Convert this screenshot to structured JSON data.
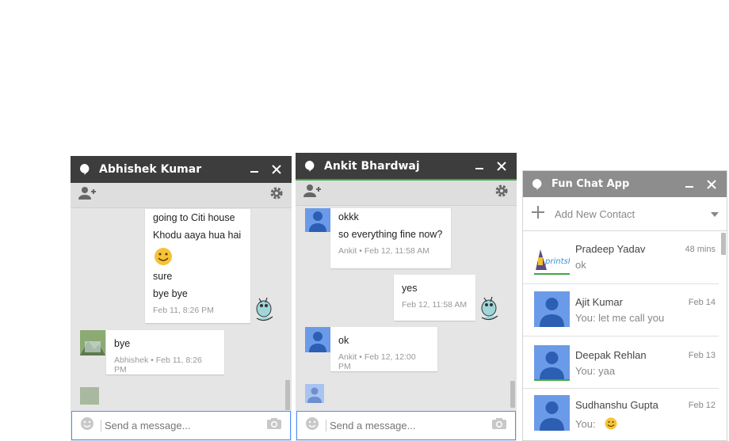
{
  "colors": {
    "titlebar_dark": "#3d3d3d",
    "titlebar_grey": "#8d8d8d",
    "accent_green": "#3ea83e",
    "input_border": "#4d90fe",
    "avatar_blue": "#6b9be8"
  },
  "chat1": {
    "title": "Abhishek Kumar",
    "messages": [
      {
        "lines": [
          "going to Citi house",
          "Khodu aaya hua hai",
          "",
          "sure",
          "bye bye"
        ],
        "meta": "Feb 11, 8:26 PM"
      },
      {
        "lines": [
          "bye"
        ],
        "meta": "Abhishek • Feb 11, 8:26 PM"
      }
    ],
    "input_placeholder": "Send a message..."
  },
  "chat2": {
    "title": "Ankit Bhardwaj",
    "messages": [
      {
        "lines": [
          "okkk",
          "so everything fine now?"
        ],
        "meta": "Ankit • Feb 12, 11:58 AM"
      },
      {
        "lines": [
          "yes"
        ],
        "meta": "Feb 12, 11:58 AM"
      },
      {
        "lines": [
          "ok"
        ],
        "meta": "Ankit • Feb 12, 12:00 PM"
      }
    ],
    "input_placeholder": "Send a message..."
  },
  "contacts": {
    "title": "Fun Chat App",
    "add_label": "Add New Contact",
    "items": [
      {
        "name": "Pradeep Yadav",
        "snippet": "ok",
        "date": "48 mins",
        "logo_text": "printshop"
      },
      {
        "name": "Ajit Kumar",
        "snippet": "You: let me call you",
        "date": "Feb 14"
      },
      {
        "name": "Deepak Rehlan",
        "snippet": "You: yaa",
        "date": "Feb 13"
      },
      {
        "name": "Sudhanshu Gupta",
        "snippet": "You:",
        "date": "Feb 12"
      }
    ]
  }
}
